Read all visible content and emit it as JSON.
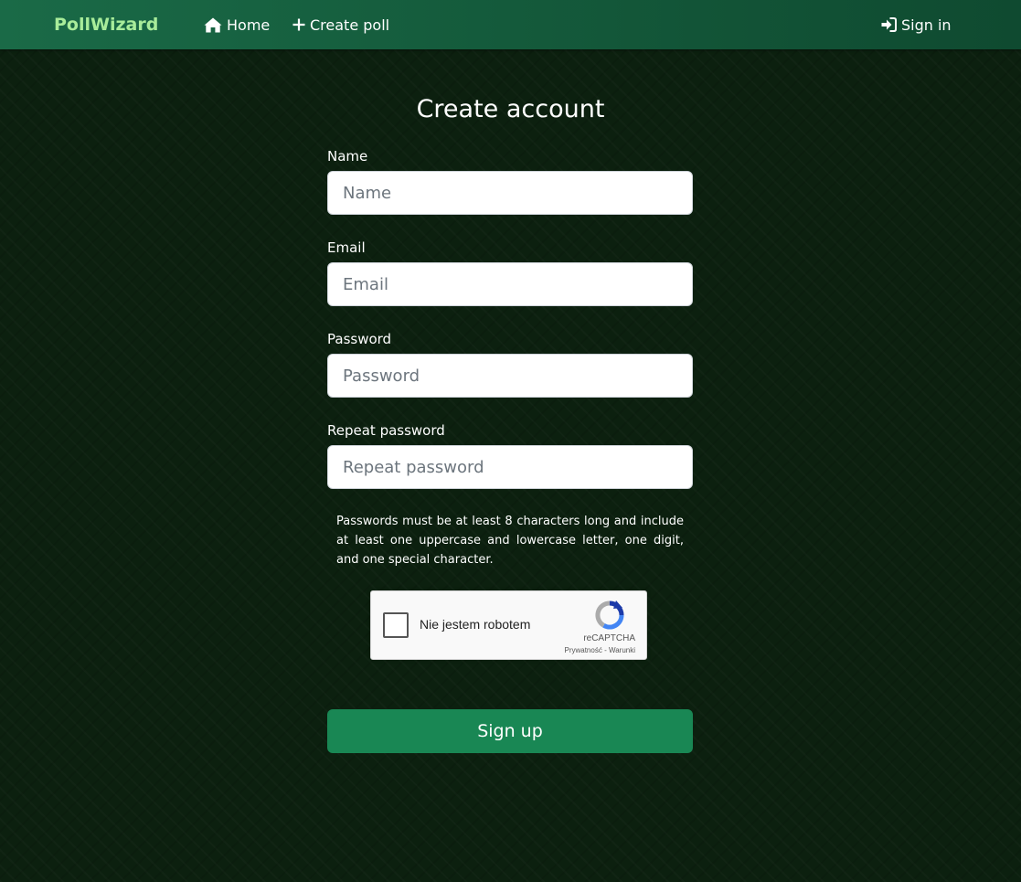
{
  "navbar": {
    "brand": "PollWizard",
    "home_label": "Home",
    "create_poll_label": "Create poll",
    "sign_in_label": "Sign in",
    "brand_color": "#a8ec9a"
  },
  "form": {
    "title": "Create account",
    "fields": [
      {
        "label": "Name",
        "placeholder": "Name",
        "value": ""
      },
      {
        "label": "Email",
        "placeholder": "Email",
        "value": ""
      },
      {
        "label": "Password",
        "placeholder": "Password",
        "value": ""
      },
      {
        "label": "Repeat password",
        "placeholder": "Repeat password",
        "value": ""
      }
    ],
    "password_hint": "Passwords must be at least 8 characters long and include at least one uppercase and lowercase letter, one digit, and one special character.",
    "submit_label": "Sign up",
    "submit_color": "#198754"
  },
  "captcha": {
    "checkbox_label": "Nie jestem robotem",
    "brand": "reCAPTCHA",
    "privacy_label": "Prywatność",
    "separator": " - ",
    "terms_label": "Warunki",
    "icon": "recaptcha-logo-icon"
  },
  "icons": {
    "home": "home-icon",
    "create": "plus-icon",
    "sign_in": "sign-in-icon"
  }
}
